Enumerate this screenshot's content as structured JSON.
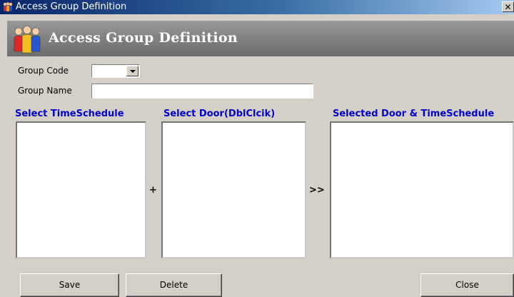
{
  "window": {
    "title": "Access Group Definition",
    "close_glyph": "✕"
  },
  "banner": {
    "title": "Access Group Definition",
    "icon": "people-group-icon"
  },
  "form": {
    "group_code_label": "Group Code",
    "group_code_value": "",
    "group_name_label": "Group Name",
    "group_name_value": ""
  },
  "sections": {
    "timeschedule_label": "Select TimeSchedule",
    "door_label": "Select Door(DblClcik)",
    "selected_label": "Selected Door & TimeSchedule",
    "plus": "+",
    "move": ">>"
  },
  "buttons": {
    "save": "Save",
    "delete": "Delete",
    "close": "Close"
  },
  "colors": {
    "section_label": "#0000c8",
    "title_bar": "#0a246a",
    "dialog_bg": "#d4d0c8"
  }
}
